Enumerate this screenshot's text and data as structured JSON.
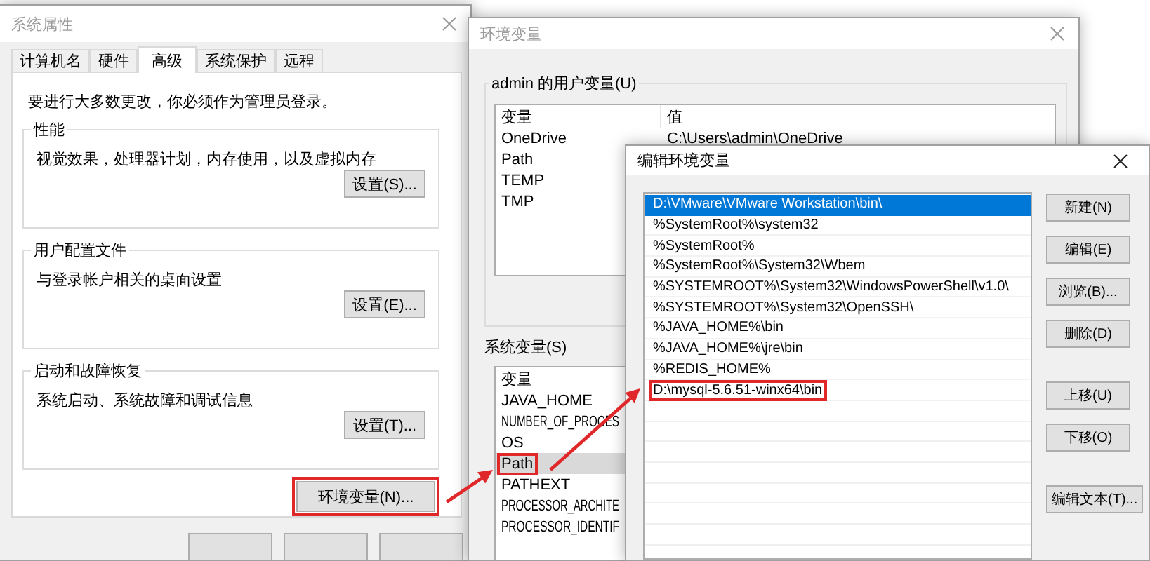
{
  "system_properties": {
    "title": "系统属性",
    "active": false,
    "tabs": [
      {
        "label": "计算机名",
        "selected": false
      },
      {
        "label": "硬件",
        "selected": false
      },
      {
        "label": "高级",
        "selected": true
      },
      {
        "label": "系统保护",
        "selected": false
      },
      {
        "label": "远程",
        "selected": false
      }
    ],
    "notice": "要进行大多数更改，你必须作为管理员登录。",
    "groups": [
      {
        "title": "性能",
        "description": "视觉效果，处理器计划，内存使用，以及虚拟内存",
        "button": "设置(S)..."
      },
      {
        "title": "用户配置文件",
        "description": "与登录帐户相关的桌面设置",
        "button": "设置(E)..."
      },
      {
        "title": "启动和故障恢复",
        "description": "系统启动、系统故障和调试信息",
        "button": "设置(T)..."
      }
    ],
    "env_button": {
      "label": "环境变量(N)...",
      "highlighted": true
    }
  },
  "environment_variables": {
    "title": "环境变量",
    "active": false,
    "user_section": {
      "title": "admin 的用户变量(U)",
      "columns": [
        "变量",
        "值"
      ],
      "rows": [
        {
          "name": "OneDrive",
          "value": "C:\\Users\\admin\\OneDrive",
          "selected": false
        },
        {
          "name": "Path",
          "selected": false
        },
        {
          "name": "TEMP",
          "selected": false
        },
        {
          "name": "TMP",
          "selected": false
        }
      ]
    },
    "system_section": {
      "title": "系统变量(S)",
      "columns": [
        "变量"
      ],
      "rows": [
        {
          "name": "JAVA_HOME",
          "selected": false,
          "highlighted": false
        },
        {
          "name": "NUMBER_OF_PROCES",
          "selected": false,
          "highlighted": false
        },
        {
          "name": "OS",
          "selected": false,
          "highlighted": false
        },
        {
          "name": "Path",
          "selected": true,
          "highlighted": true
        },
        {
          "name": "PATHEXT",
          "selected": false,
          "highlighted": false
        },
        {
          "name": "PROCESSOR_ARCHITE",
          "selected": false,
          "highlighted": false
        },
        {
          "name": "PROCESSOR_IDENTIF",
          "selected": false,
          "highlighted": false
        }
      ]
    }
  },
  "edit_variable": {
    "title": "编辑环境变量",
    "active": true,
    "items": [
      {
        "text": "D:\\VMware\\VMware Workstation\\bin\\",
        "selected": true,
        "highlighted": false
      },
      {
        "text": "%SystemRoot%\\system32",
        "selected": false,
        "highlighted": false
      },
      {
        "text": "%SystemRoot%",
        "selected": false,
        "highlighted": false
      },
      {
        "text": "%SystemRoot%\\System32\\Wbem",
        "selected": false,
        "highlighted": false
      },
      {
        "text": "%SYSTEMROOT%\\System32\\WindowsPowerShell\\v1.0\\",
        "selected": false,
        "highlighted": false
      },
      {
        "text": "%SYSTEMROOT%\\System32\\OpenSSH\\",
        "selected": false,
        "highlighted": false
      },
      {
        "text": "%JAVA_HOME%\\bin",
        "selected": false,
        "highlighted": false
      },
      {
        "text": "%JAVA_HOME%\\jre\\bin",
        "selected": false,
        "highlighted": false
      },
      {
        "text": "%REDIS_HOME%",
        "selected": false,
        "highlighted": false
      },
      {
        "text": "D:\\mysql-5.6.51-winx64\\bin",
        "selected": false,
        "highlighted": true
      }
    ],
    "button_groups": [
      [
        "新建(N)",
        "编辑(E)",
        "浏览(B)...",
        "删除(D)"
      ],
      [
        "上移(U)",
        "下移(O)"
      ],
      [
        "编辑文本(T)..."
      ]
    ]
  }
}
